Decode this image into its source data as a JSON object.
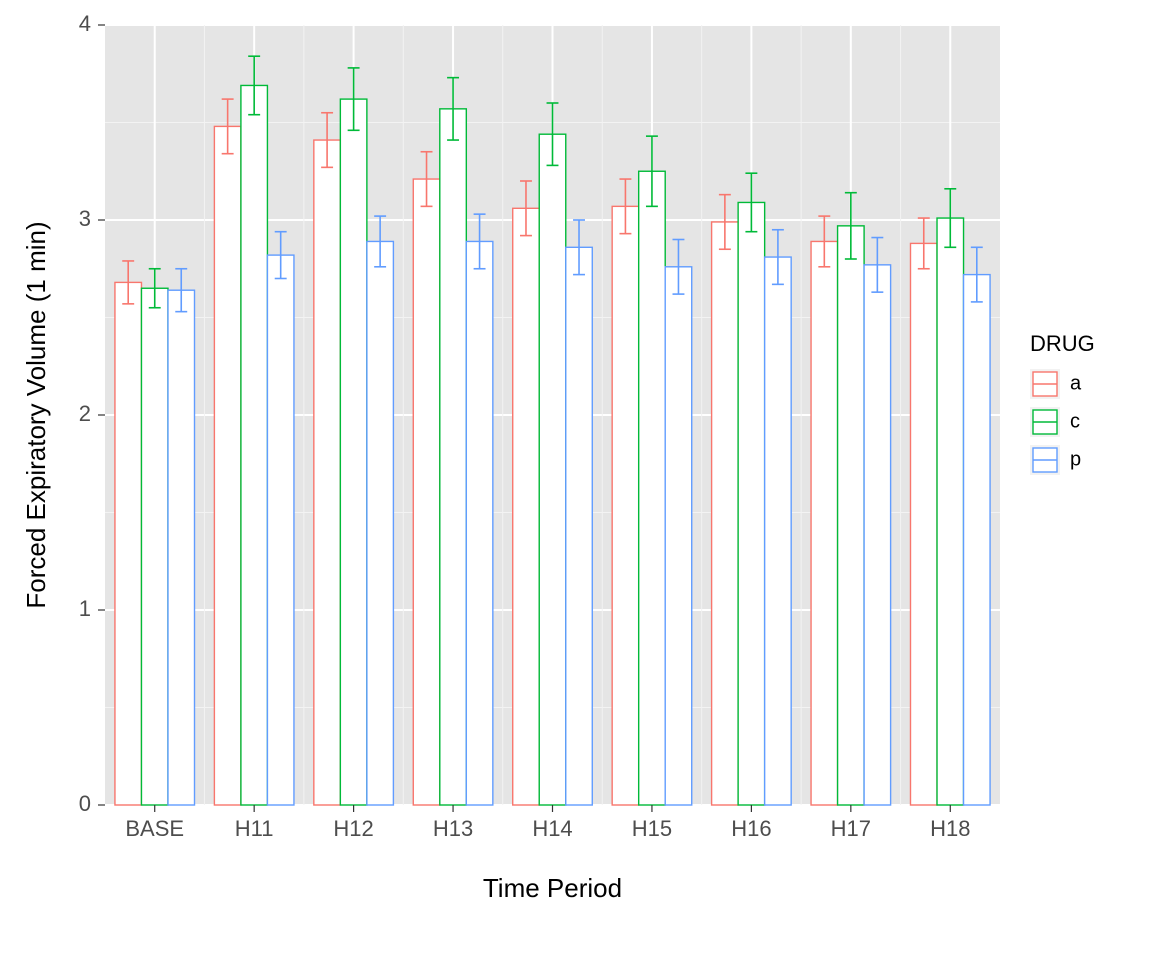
{
  "chart_data": {
    "type": "bar",
    "xlabel": "Time Period",
    "ylabel": "Forced Expiratory Volume (1 min)",
    "ylim": [
      0,
      4
    ],
    "yticks": [
      0,
      1,
      2,
      3,
      4
    ],
    "categories": [
      "BASE",
      "H11",
      "H12",
      "H13",
      "H14",
      "H15",
      "H16",
      "H17",
      "H18"
    ],
    "legend_title": "DRUG",
    "colors": {
      "a": "#F8766D",
      "c": "#00BA38",
      "p": "#619CFF"
    },
    "bar_fill": "#FFFFFF",
    "series": [
      {
        "name": "a",
        "values": [
          2.68,
          3.48,
          3.41,
          3.21,
          3.06,
          3.07,
          2.99,
          2.89,
          2.88
        ],
        "errors": [
          0.11,
          0.14,
          0.14,
          0.14,
          0.14,
          0.14,
          0.14,
          0.13,
          0.13
        ]
      },
      {
        "name": "c",
        "values": [
          2.65,
          3.69,
          3.62,
          3.57,
          3.44,
          3.25,
          3.09,
          2.97,
          3.01
        ],
        "errors": [
          0.1,
          0.15,
          0.16,
          0.16,
          0.16,
          0.18,
          0.15,
          0.17,
          0.15
        ]
      },
      {
        "name": "p",
        "values": [
          2.64,
          2.82,
          2.89,
          2.89,
          2.86,
          2.76,
          2.81,
          2.77,
          2.72
        ],
        "errors": [
          0.11,
          0.12,
          0.13,
          0.14,
          0.14,
          0.14,
          0.14,
          0.14,
          0.14
        ]
      }
    ]
  }
}
